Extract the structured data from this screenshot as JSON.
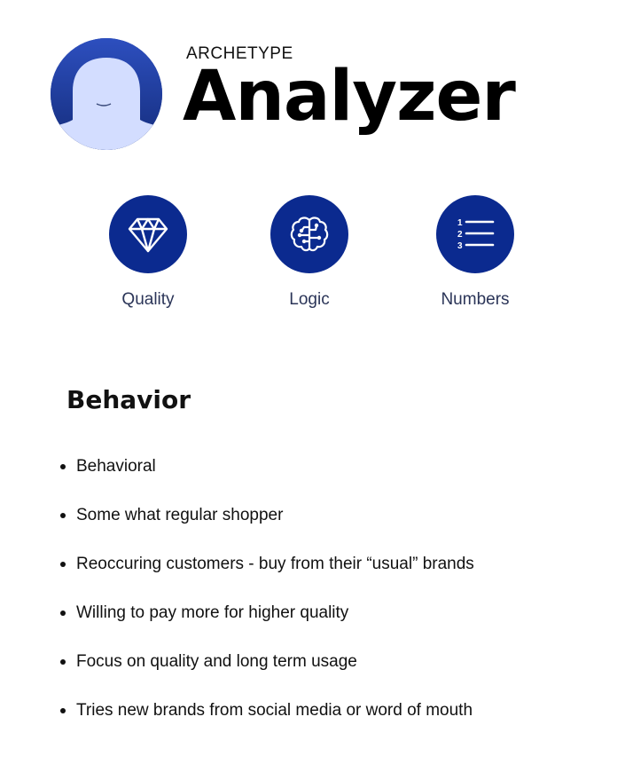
{
  "header": {
    "label": "ARCHETYPE",
    "name": "Analyzer"
  },
  "avatar": {
    "icon": "person-silhouette-icon"
  },
  "traits": [
    {
      "label": "Quality",
      "icon": "diamond-icon"
    },
    {
      "label": "Logic",
      "icon": "brain-circuit-icon"
    },
    {
      "label": "Numbers",
      "icon": "numbered-list-icon"
    }
  ],
  "behavior": {
    "title": "Behavior",
    "items": [
      "Behavioral",
      "Some what regular shopper",
      "Reoccuring customers - buy from their “usual” brands",
      "Willing to pay more for higher quality",
      "Focus on quality and long term usage",
      "Tries new brands from social media or word of mouth"
    ]
  },
  "colors": {
    "icon_circle": "#0b2a8f",
    "avatar_hair": "#1f3c9a",
    "avatar_face": "#d3ddff",
    "trait_label": "#2b3558"
  }
}
